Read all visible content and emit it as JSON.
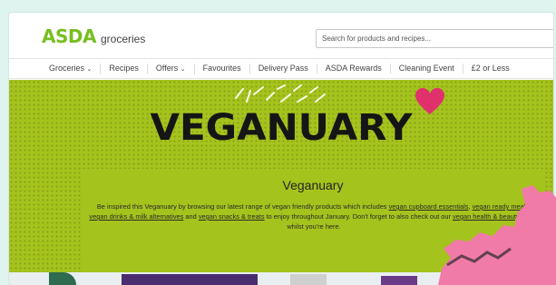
{
  "header": {
    "logo_brand": "ASDA",
    "logo_sub": "groceries",
    "search_placeholder": "Search for products and recipes..."
  },
  "nav": {
    "items": [
      {
        "label": "Groceries",
        "dropdown": true
      },
      {
        "label": "Recipes",
        "dropdown": false
      },
      {
        "label": "Offers",
        "dropdown": true
      },
      {
        "label": "Favourites",
        "dropdown": false
      },
      {
        "label": "Delivery Pass",
        "dropdown": false
      },
      {
        "label": "ASDA Rewards",
        "dropdown": false
      },
      {
        "label": "Cleaning Event",
        "dropdown": false
      },
      {
        "label": "£2 or Less",
        "dropdown": false
      }
    ]
  },
  "banner": {
    "title": "VEGANUARY",
    "heading": "Veganuary",
    "desc_1": "Be inspired this Veganuary by browsing our latest range of vegan friendly products which includes ",
    "link_1": "vegan cupboard essentials",
    "desc_2": ", ",
    "link_2": "vegan ready meals",
    "desc_3": ", ",
    "link_3": "vegan drinks & milk alternatives",
    "desc_4": " and ",
    "link_4": "vegan snacks & treats",
    "desc_5": " to enjoy throughout January. Don't forget to also check out our ",
    "link_5": "vegan health & beauty",
    "desc_6": " range whilst you're here."
  },
  "colors": {
    "brand_green": "#78be20",
    "banner_green": "#a5c31d",
    "heart_pink": "#e0316c",
    "decor_pink": "#f07aa8"
  }
}
